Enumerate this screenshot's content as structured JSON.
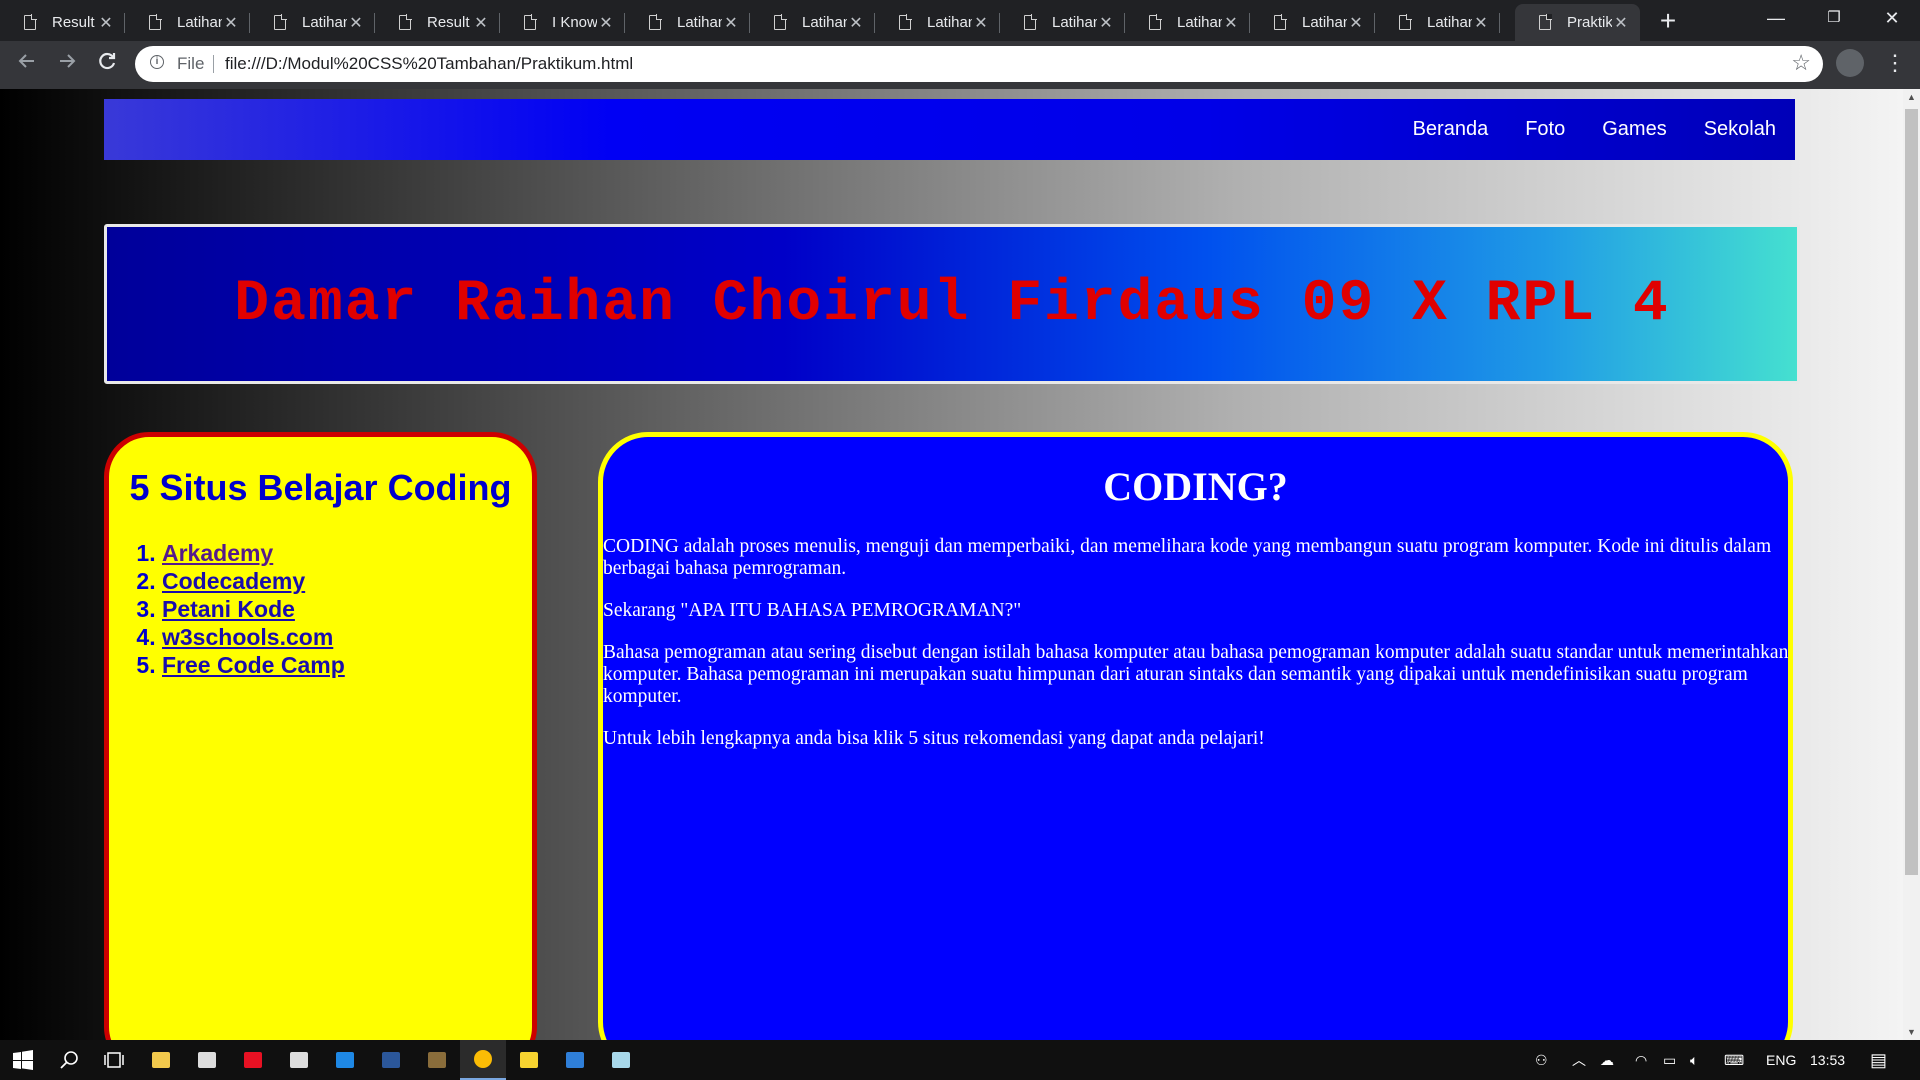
{
  "browser": {
    "tabs": [
      {
        "label": "Result"
      },
      {
        "label": "Latihan"
      },
      {
        "label": "Latihan"
      },
      {
        "label": "Result"
      },
      {
        "label": "I Know"
      },
      {
        "label": "Latihan"
      },
      {
        "label": "Latihan"
      },
      {
        "label": "Latihan"
      },
      {
        "label": "Latihan"
      },
      {
        "label": "Latihan"
      },
      {
        "label": "Latihan"
      },
      {
        "label": "Latihan"
      },
      {
        "label": "Praktik"
      }
    ],
    "active_tab_index": 12,
    "new_tab_symbol": "+",
    "window_controls": {
      "minimize": "—",
      "restore": "❐",
      "close": "✕"
    },
    "address": {
      "scheme_label": "File",
      "url": "file:///D:/Modul%20CSS%20Tambahan/Praktikum.html"
    }
  },
  "page": {
    "nav": [
      "Beranda",
      "Foto",
      "Games",
      "Sekolah"
    ],
    "banner_title": "Damar Raihan Choirul Firdaus 09 X RPL 4",
    "sidebar": {
      "title": "5 Situs Belajar Coding",
      "links": [
        {
          "label": "Arkademy",
          "visited": true
        },
        {
          "label": "Codecademy",
          "visited": false
        },
        {
          "label": "Petani Kode",
          "visited": false
        },
        {
          "label": "w3schools.com",
          "visited": false
        },
        {
          "label": "Free Code Camp",
          "visited": false
        }
      ]
    },
    "main": {
      "title": "CODING?",
      "paragraphs": [
        "CODING adalah proses menulis, menguji dan memperbaiki, dan memelihara kode yang membangun suatu program komputer. Kode ini ditulis dalam berbagai bahasa pemrograman.",
        "Sekarang \"APA ITU BAHASA PEMROGRAMAN?\"",
        "Bahasa pemograman atau sering disebut dengan istilah bahasa komputer atau bahasa pemograman komputer adalah suatu standar untuk memerintahkan komputer. Bahasa pemograman ini merupakan suatu himpunan dari aturan sintaks dan semantik yang dipakai untuk mendefinisikan suatu program komputer.",
        "Untuk lebih lengkapnya anda bisa klik 5 situs rekomendasi yang dapat anda pelajari!"
      ]
    },
    "colors": {
      "nav_bg": "#0000f4",
      "banner_title": "#e00000",
      "sidebar_bg": "#ffff00",
      "sidebar_border": "#cc0000",
      "main_bg": "#0000ff",
      "main_border": "#ffff00"
    }
  },
  "taskbar": {
    "apps": [
      "file-explorer-icon",
      "store-icon",
      "gift-icon",
      "mail-icon",
      "edge-icon",
      "word-icon",
      "app-icon",
      "chrome-icon",
      "sticky-notes-icon",
      "vscode-icon",
      "notepad-icon"
    ],
    "language": "ENG",
    "time": "13:53"
  }
}
